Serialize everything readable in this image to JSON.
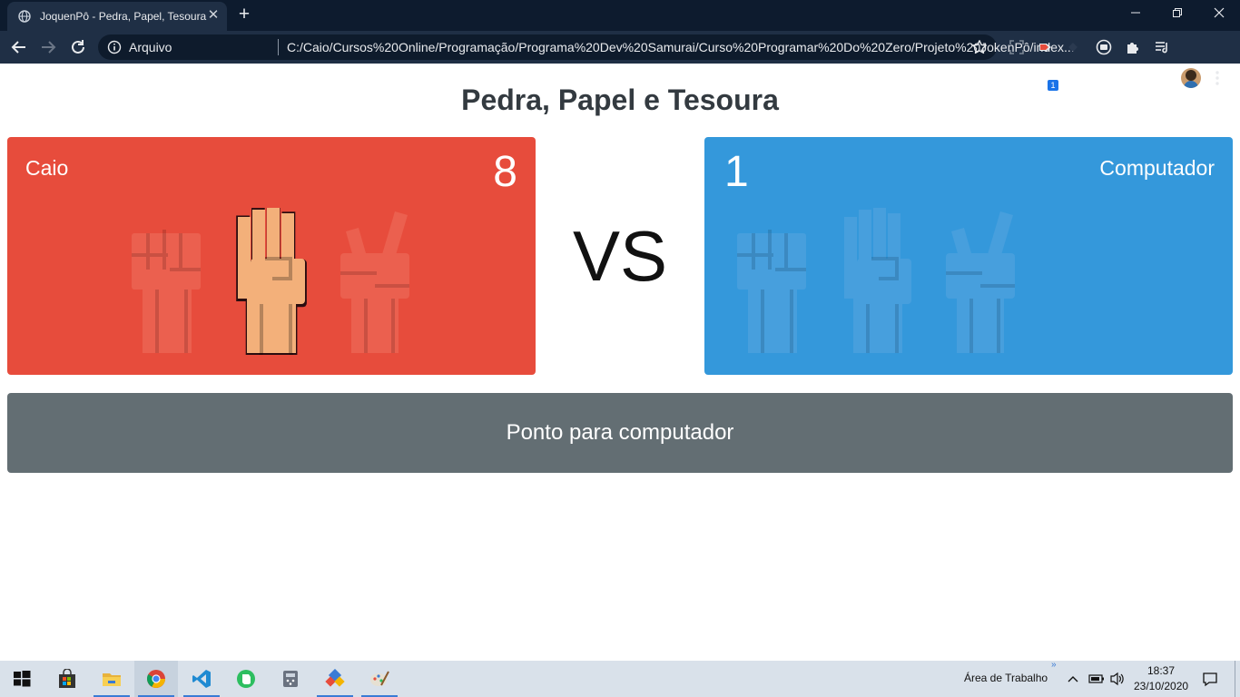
{
  "browser": {
    "tab_title": "JoquenPô - Pedra, Papel, Tesoura",
    "scheme_label": "Arquivo",
    "url": "C:/Caio/Cursos%20Online/Programação/Programa%20Dev%20Samurai/Curso%20Programar%20Do%20Zero/Projeto%20JokenPô/index...",
    "extension_badge": "1"
  },
  "game": {
    "title": "Pedra, Papel e Tesoura",
    "vs_label": "VS",
    "player": {
      "name": "Caio",
      "score": "8",
      "color": "#e74c3c",
      "selected": "paper"
    },
    "computer": {
      "name": "Computador",
      "score": "1",
      "color": "#3498db",
      "selected": "none"
    },
    "result": "Ponto para computador",
    "hands": [
      "rock-icon",
      "paper-icon",
      "scissors-icon"
    ]
  },
  "taskbar": {
    "desktop_label": "Área de Trabalho",
    "time": "18:37",
    "date": "23/10/2020",
    "apps": [
      "store-icon",
      "file-explorer-icon",
      "chrome-icon",
      "vscode-icon",
      "evernote-icon",
      "calculator-icon",
      "snipping-icon",
      "paint-icon"
    ]
  }
}
